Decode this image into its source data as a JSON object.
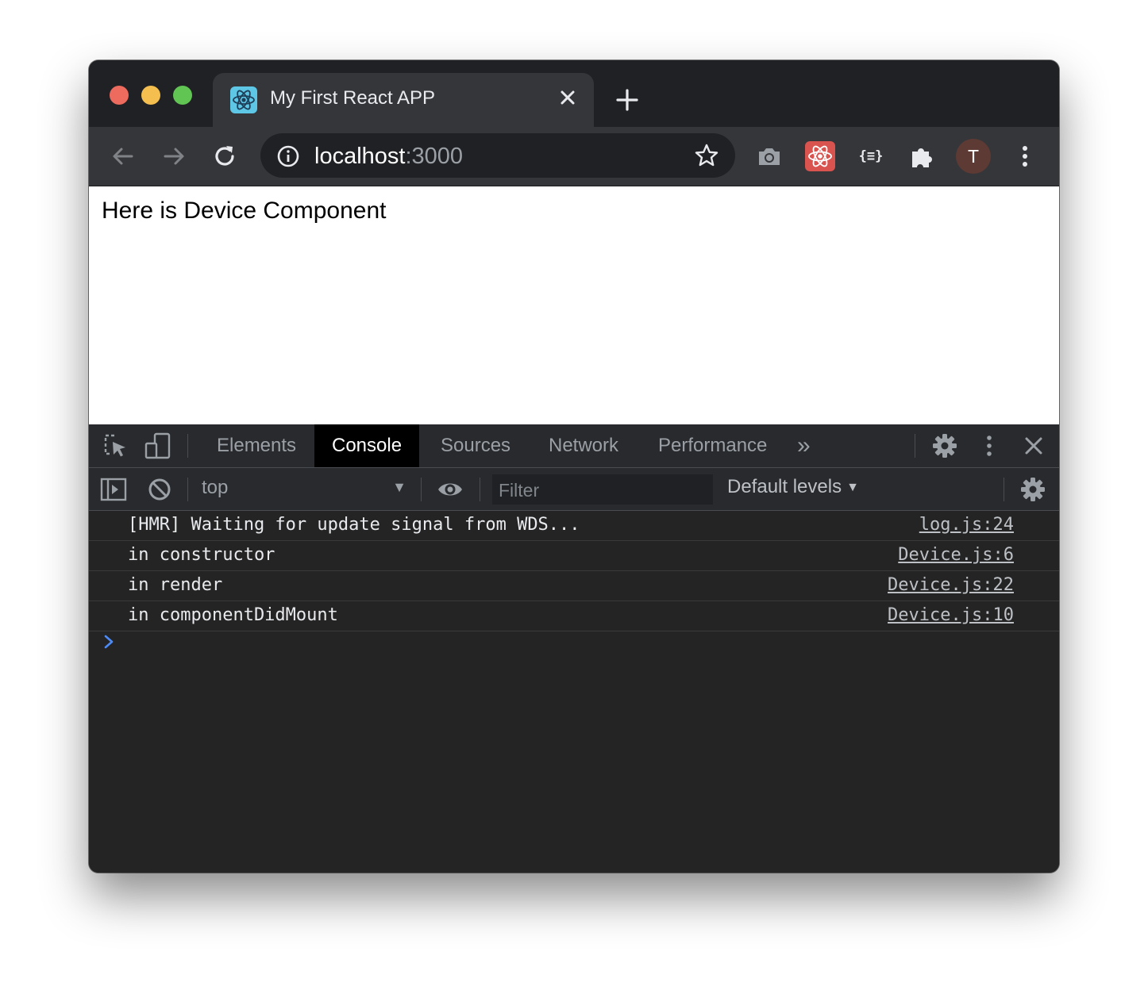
{
  "browser": {
    "tab": {
      "title": "My First React APP",
      "favicon": "react-logo-icon"
    },
    "address": {
      "host": "localhost",
      "port": ":3000"
    },
    "avatar_initial": "T",
    "extensions": {
      "json_formatter_label": "{≡}"
    }
  },
  "page": {
    "text": "Here is Device Component"
  },
  "devtools": {
    "tabs": [
      "Elements",
      "Console",
      "Sources",
      "Network",
      "Performance"
    ],
    "more_label": "»",
    "active_tab": "Console",
    "console": {
      "context": "top",
      "filter_placeholder": "Filter",
      "levels": "Default levels",
      "logs": [
        {
          "message": "[HMR] Waiting for update signal from WDS...",
          "source": "log.js:24"
        },
        {
          "message": "in constructor",
          "source": "Device.js:6"
        },
        {
          "message": "in render",
          "source": "Device.js:22"
        },
        {
          "message": "in componentDidMount",
          "source": "Device.js:10"
        }
      ]
    }
  },
  "colors": {
    "traffic_red": "#ed6a5e",
    "traffic_yellow": "#f4bf4f",
    "traffic_green": "#61c554",
    "devtools_bg": "#242424",
    "prompt_blue": "#4c8bf5"
  }
}
